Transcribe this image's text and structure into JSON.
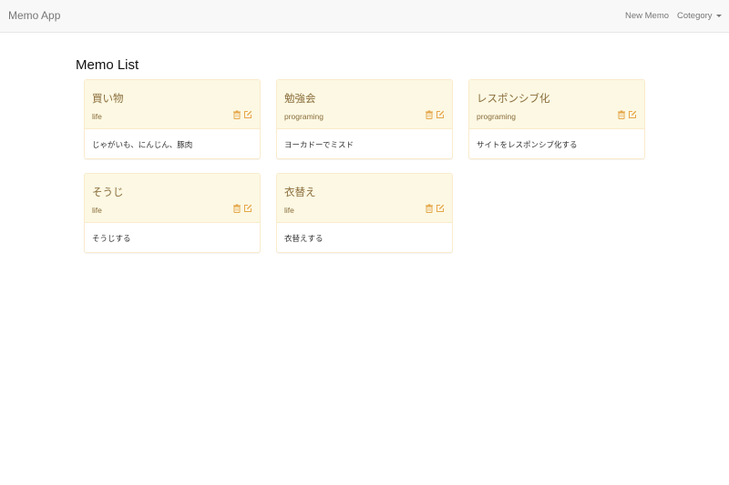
{
  "navbar": {
    "brand": "Memo App",
    "new_memo": "New Memo",
    "category": "Cotegory"
  },
  "page": {
    "title": "Memo List"
  },
  "memos": [
    {
      "title": "買い物",
      "category": "life",
      "body": "じゃがいも、にんじん、豚肉"
    },
    {
      "title": "勉強会",
      "category": "programing",
      "body": "ヨーカドーでミスド"
    },
    {
      "title": "レスポンシブ化",
      "category": "programing",
      "body": "サイトをレスポンシブ化する"
    },
    {
      "title": "そうじ",
      "category": "life",
      "body": "そうじする"
    },
    {
      "title": "衣替え",
      "category": "life",
      "body": "衣替えする"
    }
  ],
  "colors": {
    "panel_heading_bg": "#fcf8e3",
    "panel_border": "#faebcc",
    "panel_text": "#8a6d3b",
    "icon": "#e5a64a"
  },
  "icons": {
    "delete": "trash-icon",
    "edit": "edit-icon"
  }
}
